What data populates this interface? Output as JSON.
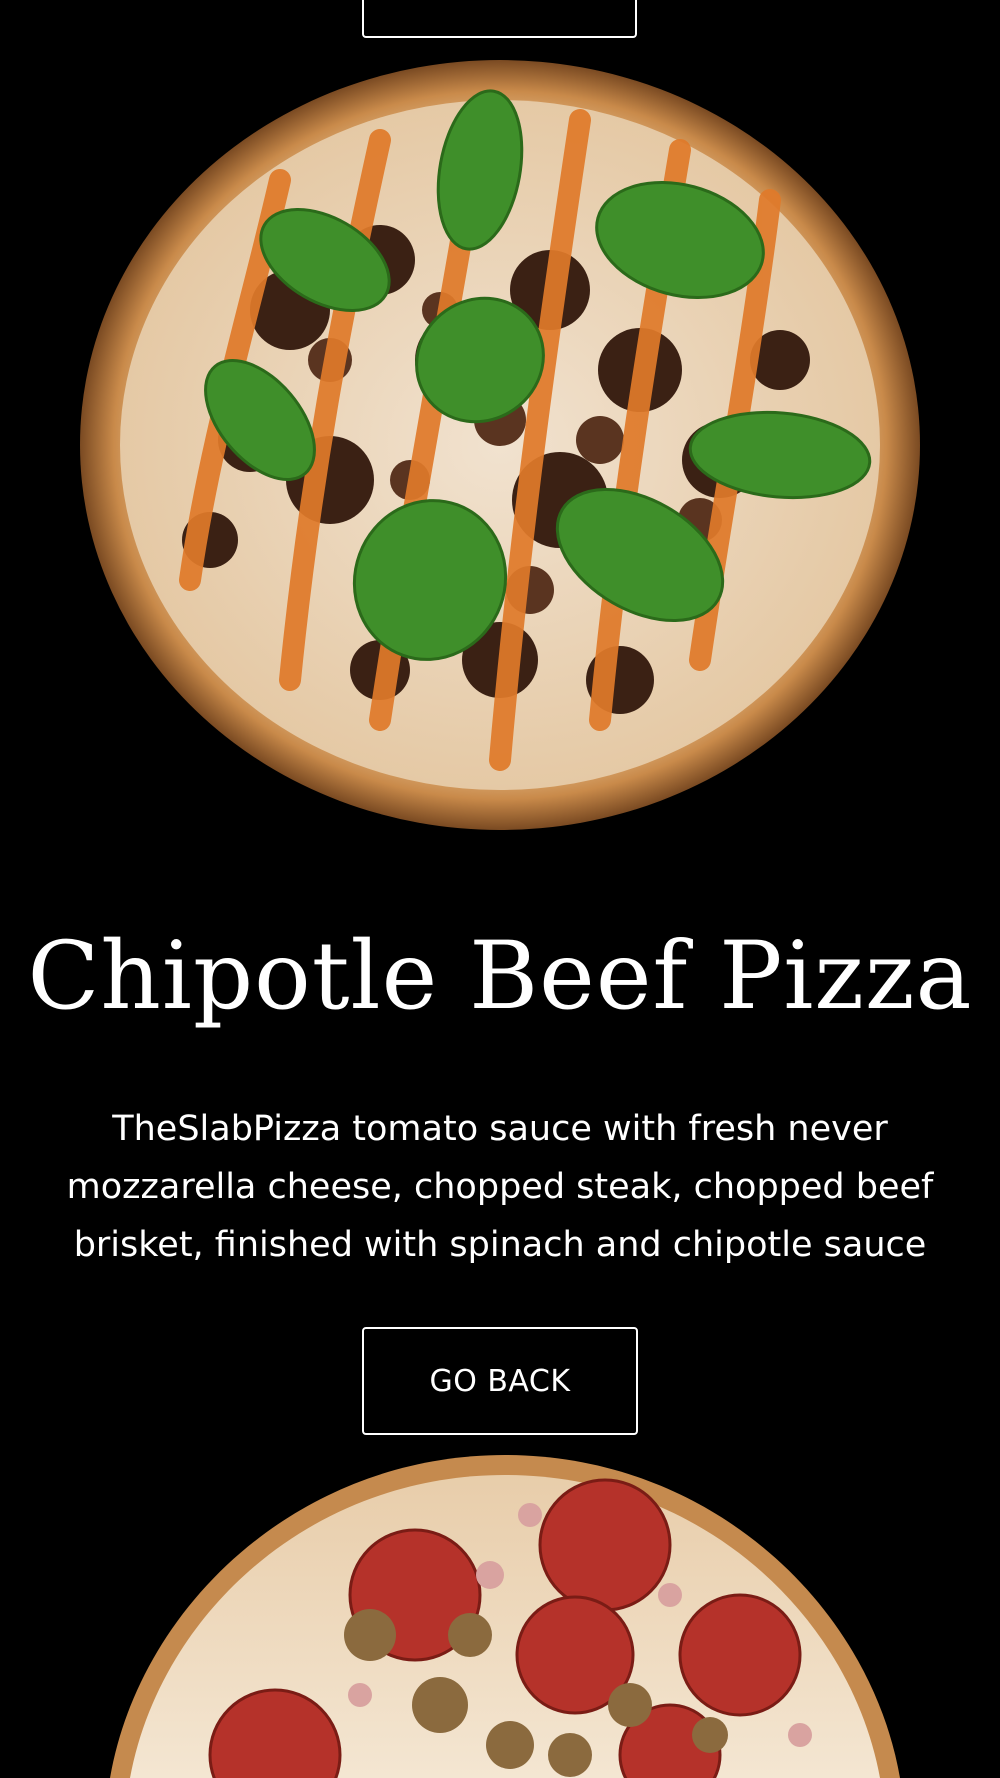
{
  "product": {
    "title": "Chipotle Beef Pizza",
    "description": "TheSlabPizza tomato sauce with fresh never mozzarella cheese, chopped steak, chopped beef brisket, finished with spinach and chipotle sauce",
    "go_back_label": "GO BACK"
  },
  "colors": {
    "background": "#000000",
    "text": "#ffffff",
    "button_border": "#ffffff"
  },
  "images": {
    "main_pizza": "chipotle-beef-pizza-image",
    "next_pizza": "pepperoni-sausage-pizza-image"
  }
}
